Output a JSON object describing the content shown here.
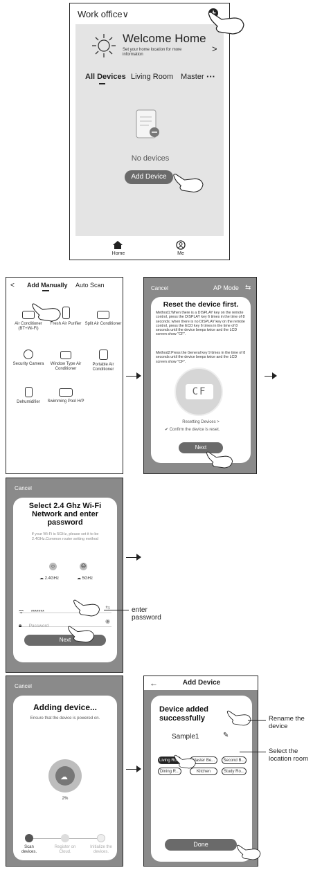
{
  "screen1": {
    "location": "Work office",
    "welcome_title": "Welcome Home",
    "welcome_sub": "Set your home location for more information",
    "tabs": [
      "All Devices",
      "Living Room",
      "Master"
    ],
    "more": "···",
    "empty_text": "No devices",
    "add_button": "Add Device",
    "nav": [
      {
        "label": "Home",
        "icon": "home-icon"
      },
      {
        "label": "Me",
        "icon": "person-icon"
      }
    ]
  },
  "screen2": {
    "back": "<",
    "tab_manual": "Add Manually",
    "tab_scan": "Auto Scan",
    "devices": [
      {
        "label": "Air Conditioner (BT+Wi-Fi)",
        "icon": "air-conditioner-icon"
      },
      {
        "label": "Fresh Air Purifier",
        "icon": "purifier-icon"
      },
      {
        "label": "Split Air Conditioner",
        "icon": "split-ac-icon"
      },
      {
        "label": "Security Camera",
        "icon": "camera-icon"
      },
      {
        "label": "Window Type Air Conditioner",
        "icon": "window-ac-icon"
      },
      {
        "label": "Portable Air Conditioner",
        "icon": "portable-ac-icon"
      },
      {
        "label": "Dehumidifier",
        "icon": "dehumidifier-icon"
      },
      {
        "label": "Swimming Pool H/P",
        "icon": "pool-hp-icon"
      }
    ]
  },
  "screen3": {
    "cancel": "Cancel",
    "mode": "AP Mode",
    "title": "Reset the device first.",
    "method1": "Method1:When there is a DISPLAY key on the remote control, press the DISPLAY key 6 times in the time of 8 seconds; when there is no DISPLAY key on the remote control, press the ECO key 6 times in the time of 8 seconds until the device beeps twice and the LCD screen show \"CF\".",
    "method2": "Method2:Press the General key 9 times in the time of 8 seconds until the device beeps twice and the LCD screen show \"CF\".",
    "display_code": "CF",
    "resetting": "Resetting Devices >",
    "confirm": "Confirm the device is reset.",
    "next": "Next"
  },
  "screen4": {
    "cancel": "Cancel",
    "title": "Select 2.4 Ghz Wi-Fi Network and enter password",
    "note": "If your Wi-Fi is 5GHz, please set it to be 2.4GHz.Common router setting method",
    "band_ok": "2.4GHz",
    "band_bad": "5GHz",
    "wifi_name": "*******",
    "password_placeholder": "Password",
    "next": "Next",
    "callout": "enter password"
  },
  "screen5": {
    "cancel": "Cancel",
    "title": "Adding device...",
    "subtitle": "Ensure that the device is powered on.",
    "progress_label": "2%",
    "progress": 0.02,
    "steps": [
      "Scan devices.",
      "Register on Cloud.",
      "Initialize the devices."
    ]
  },
  "screen6": {
    "back": "←",
    "title": "Add Device",
    "success": "Device added successfully",
    "name": "Sample1",
    "rooms": [
      "Living Ro...",
      "Master Be...",
      "Second B...",
      "Dining R...",
      "Kitchen",
      "Study Ro..."
    ],
    "done": "Done",
    "callout_rename": "Rename the device",
    "callout_room": "Select the location room"
  }
}
